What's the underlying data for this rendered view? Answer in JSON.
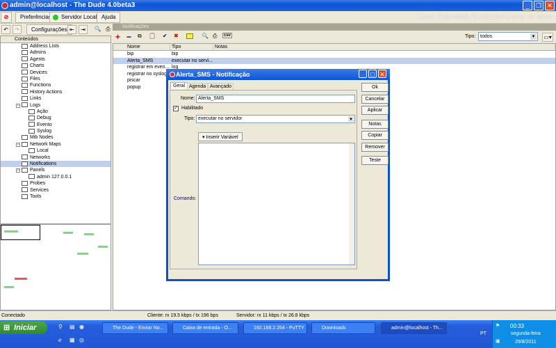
{
  "window": {
    "title": "admin@localhost - The Dude 4.0beta3",
    "banner": "Long Distance Wireless links -> www"
  },
  "menu": {
    "preferences": "Preferências",
    "local_server": "Servidor Local",
    "help": "Ajuda"
  },
  "toolbar": {
    "settings": "Configurações"
  },
  "sidebar": {
    "header": "Conteúdos",
    "items": [
      {
        "label": "Address Lists",
        "level": 1
      },
      {
        "label": "Admins",
        "level": 1
      },
      {
        "label": "Agents",
        "level": 1
      },
      {
        "label": "Charts",
        "level": 1
      },
      {
        "label": "Devices",
        "level": 1
      },
      {
        "label": "Files",
        "level": 1
      },
      {
        "label": "Functions",
        "level": 1
      },
      {
        "label": "History Actions",
        "level": 1
      },
      {
        "label": "Links",
        "level": 1
      },
      {
        "label": "Logs",
        "level": 1,
        "expanded": true
      },
      {
        "label": "Ação",
        "level": 2
      },
      {
        "label": "Debug",
        "level": 2
      },
      {
        "label": "Evento",
        "level": 2
      },
      {
        "label": "Syslog",
        "level": 2
      },
      {
        "label": "Mib Nodes",
        "level": 1
      },
      {
        "label": "Network Maps",
        "level": 1,
        "expanded": true
      },
      {
        "label": "Local",
        "level": 2
      },
      {
        "label": "Networks",
        "level": 1
      },
      {
        "label": "Notifications",
        "level": 1,
        "selected": true
      },
      {
        "label": "Panels",
        "level": 1,
        "expanded": true
      },
      {
        "label": "admin 127.0.0.1",
        "level": 2
      },
      {
        "label": "Probes",
        "level": 1
      },
      {
        "label": "Services",
        "level": 1
      },
      {
        "label": "Tools",
        "level": 1
      }
    ]
  },
  "panel": {
    "title": "Notificações",
    "filter_label": "Tipo:",
    "filter_value": "todos",
    "csv": "csv",
    "columns": [
      "Nome",
      "Tipo",
      "Notas"
    ],
    "rows": [
      [
        "bip",
        "bip",
        ""
      ],
      [
        "Alerta_SMS",
        "executar no servi...",
        ""
      ],
      [
        "registrar em even...",
        "log",
        ""
      ],
      [
        "registrar no syslog",
        "",
        ""
      ],
      [
        "piscar",
        "",
        ""
      ],
      [
        "popup",
        "",
        ""
      ]
    ]
  },
  "dialog": {
    "title": "Alerta_SMS - Notificação",
    "tabs": [
      "Geral",
      "Agenda",
      "Avançado"
    ],
    "name_label": "Nome:",
    "name_value": "Alerta_SMS",
    "enabled_label": "Habilitado",
    "enabled": true,
    "type_label": "Tipo:",
    "type_value": "executar no servidor",
    "insert_variable": "Inserir Variável",
    "command_label": "Comando:",
    "command_value": "",
    "buttons": [
      "Ok",
      "Cancelar",
      "Aplicar",
      "Notas",
      "Copiar",
      "Remover",
      "Teste"
    ]
  },
  "status": {
    "state": "Conectado",
    "client": "Cliente: rx 19.5 kbps / tx 196 bps",
    "server": "Servidor: rx 11 kbps / tx 26.8 kbps"
  },
  "taskbar": {
    "start": "Iniciar",
    "tasks": [
      "The Dude - Enviar No...",
      "Caixa de entrada - O...",
      "192.168.2.254 - PuTTY",
      "Downloads",
      "admin@localhost - Th..."
    ],
    "lang": "PT",
    "time": "00:33",
    "day": "segunda-feira",
    "date": "29/8/2011"
  }
}
